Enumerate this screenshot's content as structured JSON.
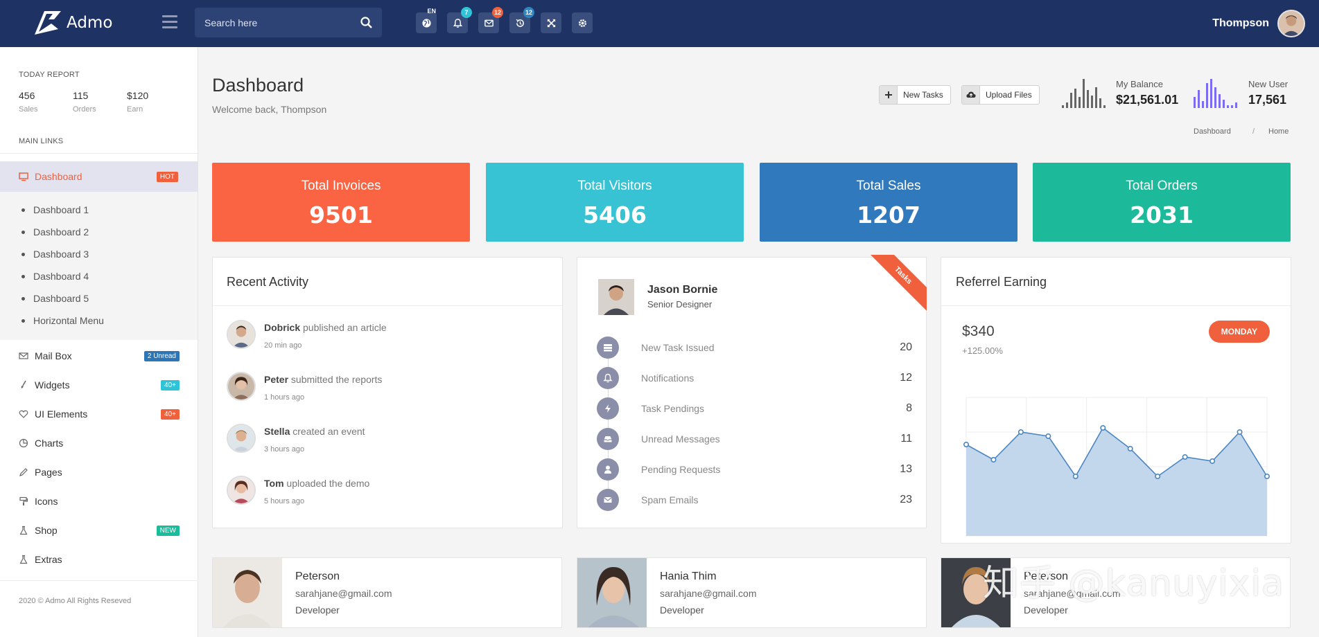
{
  "topbar": {
    "logo_text": "Admo",
    "search_placeholder": "Search here",
    "icons": [
      {
        "name": "globe-icon",
        "badge": "EN"
      },
      {
        "name": "bell-icon",
        "badge": "7",
        "badge_color": "#2ec3d6"
      },
      {
        "name": "mail-icon",
        "badge": "12",
        "badge_color": "#f0603c"
      },
      {
        "name": "history-icon",
        "badge": "12",
        "badge_color": "#2e86c1"
      },
      {
        "name": "fullscreen-icon"
      },
      {
        "name": "gear-icon"
      }
    ],
    "user_name": "Thompson"
  },
  "sidebar": {
    "report_title": "TODAY REPORT",
    "report": [
      {
        "value": "456",
        "label": "Sales"
      },
      {
        "value": "115",
        "label": "Orders"
      },
      {
        "value": "$120",
        "label": "Earn"
      }
    ],
    "links_title": "MAIN LINKS",
    "active_item": {
      "label": "Dashboard",
      "tag": "HOT",
      "tag_color": "#f0603c"
    },
    "submenu": [
      "Dashboard 1",
      "Dashboard 2",
      "Dashboard 3",
      "Dashboard 4",
      "Dashboard 5",
      "Horizontal Menu"
    ],
    "items": [
      {
        "label": "Mail Box",
        "icon": "mail-icon",
        "tag": "2 Unread",
        "tag_color": "#2e75b6"
      },
      {
        "label": "Widgets",
        "icon": "brush-icon",
        "tag": "40+",
        "tag_color": "#2ec3d6"
      },
      {
        "label": "UI Elements",
        "icon": "heart-icon",
        "tag": "40+",
        "tag_color": "#f0603c"
      },
      {
        "label": "Charts",
        "icon": "pie-chart-icon",
        "tag": ""
      },
      {
        "label": "Pages",
        "icon": "pencil-icon",
        "tag": ""
      },
      {
        "label": "Icons",
        "icon": "paint-roller-icon",
        "tag": ""
      },
      {
        "label": "Shop",
        "icon": "flask-icon",
        "tag": "NEW",
        "tag_color": "#1abc9c"
      },
      {
        "label": "Extras",
        "icon": "flask-icon",
        "tag": ""
      }
    ],
    "copyright": "2020 © Admo All Rights Reseved"
  },
  "header": {
    "title": "Dashboard",
    "subtitle": "Welcome back, Thompson",
    "new_tasks_label": "New Tasks",
    "upload_files_label": "Upload Files",
    "balance_label": "My Balance",
    "balance_value": "$21,561.01",
    "balance_color": "#666666",
    "new_user_label": "New User",
    "new_user_value": "17,561",
    "new_user_color": "#7b6cf0",
    "breadcrumb": [
      "Dashboard",
      "Home"
    ]
  },
  "kpis": [
    {
      "title": "Total Invoices",
      "value": "9501",
      "color": "#fb6443"
    },
    {
      "title": "Total Visitors",
      "value": "5406",
      "color": "#38c3d4"
    },
    {
      "title": "Total Sales",
      "value": "1207",
      "color": "#3079bd"
    },
    {
      "title": "Total Orders",
      "value": "2031",
      "color": "#1cb99a"
    }
  ],
  "activity": {
    "title": "Recent Activity",
    "items": [
      {
        "name": "Dobrick",
        "action": "published an article",
        "time": "20 min ago"
      },
      {
        "name": "Peter",
        "action": "submitted the reports",
        "time": "1 hours ago"
      },
      {
        "name": "Stella",
        "action": "created an event",
        "time": "3 hours ago"
      },
      {
        "name": "Tom",
        "action": "uploaded the demo",
        "time": "5 hours ago"
      }
    ]
  },
  "profile": {
    "name": "Jason Bornie",
    "role": "Senior Designer",
    "ribbon": "Tasks",
    "tasks": [
      {
        "label": "New Task Issued",
        "value": "20",
        "icon": "server-icon"
      },
      {
        "label": "Notifications",
        "value": "12",
        "icon": "bell-icon"
      },
      {
        "label": "Task Pendings",
        "value": "8",
        "icon": "bolt-icon"
      },
      {
        "label": "Unread Messages",
        "value": "11",
        "icon": "inbox-icon"
      },
      {
        "label": "Pending Requests",
        "value": "13",
        "icon": "user-icon"
      },
      {
        "label": "Spam Emails",
        "value": "23",
        "icon": "envelope-icon"
      }
    ]
  },
  "referral": {
    "title": "Referrel Earning",
    "amount": "$340",
    "change": "+125.00%",
    "day": "MONDAY"
  },
  "chart_data": {
    "type": "area",
    "x": [
      0,
      1,
      2,
      3,
      4,
      5,
      6,
      7,
      8,
      9,
      10,
      11
    ],
    "values": [
      66,
      55,
      75,
      72,
      43,
      78,
      63,
      43,
      57,
      54,
      75,
      43
    ],
    "ylim": [
      0,
      100
    ],
    "grid": true,
    "color": "#4a86c0",
    "fill": "#c3d7ec"
  },
  "people": [
    {
      "name": "Peterson",
      "email": "sarahjane@gmail.com",
      "role": "Developer"
    },
    {
      "name": "Hania Thim",
      "email": "sarahjane@gmail.com",
      "role": "Developer"
    },
    {
      "name": "Peterson",
      "email": "sarahjane@gmail.com",
      "role": "Developer"
    }
  ],
  "watermark": "知乎 @kanuyixia"
}
